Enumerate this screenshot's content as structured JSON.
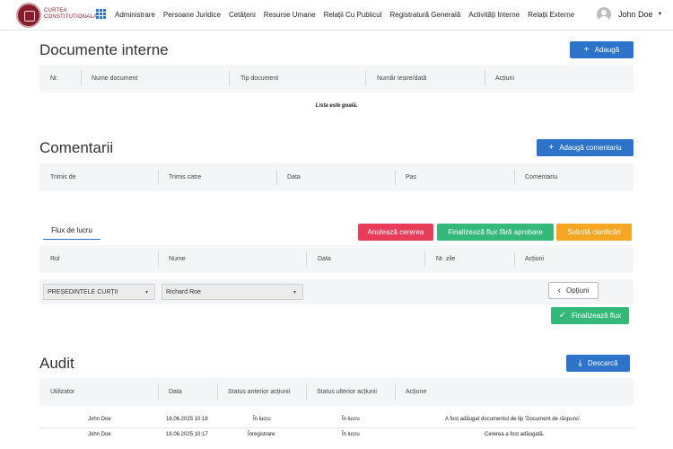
{
  "nav": {
    "logo_line1": "CURTEA",
    "logo_line2": "CONSTITUTIONALA",
    "items": [
      "Administrare",
      "Persoane Juridice",
      "Cetățeni",
      "Resurse Umane",
      "Relații Cu Publicul",
      "Registratură Generală",
      "Activități Interne",
      "Relații Externe"
    ],
    "user_name": "John Doe"
  },
  "documente": {
    "title": "Documente interne",
    "add_label": "Adaugă",
    "columns": [
      "Nr.",
      "Nume document",
      "Tip document",
      "Număr ieșire/dată",
      "Acțiuni"
    ],
    "empty_text": "Lista este goală."
  },
  "comentarii": {
    "title": "Comentarii",
    "add_label": "Adaugă comentariu",
    "columns": [
      "Trimis de",
      "Trimis catre",
      "Data",
      "Pas",
      "Comentariu"
    ]
  },
  "flux": {
    "tab_label": "Flux de lucru",
    "cancel_label": "Anulează cererea",
    "finalize_no_approval_label": "Finalizează flux fără aprobare",
    "clarify_label": "Solicită clarificări",
    "columns": [
      "Rol",
      "Nume",
      "Data",
      "Nr. zile",
      "Acțiuni"
    ],
    "role_value": "PREȘEDINTELE CURȚII",
    "name_value": "Richard Roe",
    "options_label": "Opțiuni",
    "finalize_label": "Finalizează flux"
  },
  "audit": {
    "title": "Audit",
    "download_label": "Descarcă",
    "columns": [
      "Utilizator",
      "Data",
      "Status anterior acțiunii",
      "Status ulterior acțiunii",
      "Acțiune"
    ],
    "rows": [
      {
        "user": "John Doe",
        "date": "18.06.2025 10:18",
        "prev": "În lucru",
        "next": "În lucru",
        "action": "A fost adăugat documentul de tip 'Document de răspuns'."
      },
      {
        "user": "John Doe",
        "date": "18.06.2025 10:17",
        "prev": "Înregistrare",
        "next": "În lucru",
        "action": "Cererea a fost adăugată."
      }
    ]
  },
  "colors": {
    "primary": "#2d73c9",
    "danger": "#e73c5a",
    "success": "#35b97a",
    "warning": "#f5a623",
    "brand": "#8b1c2b"
  }
}
